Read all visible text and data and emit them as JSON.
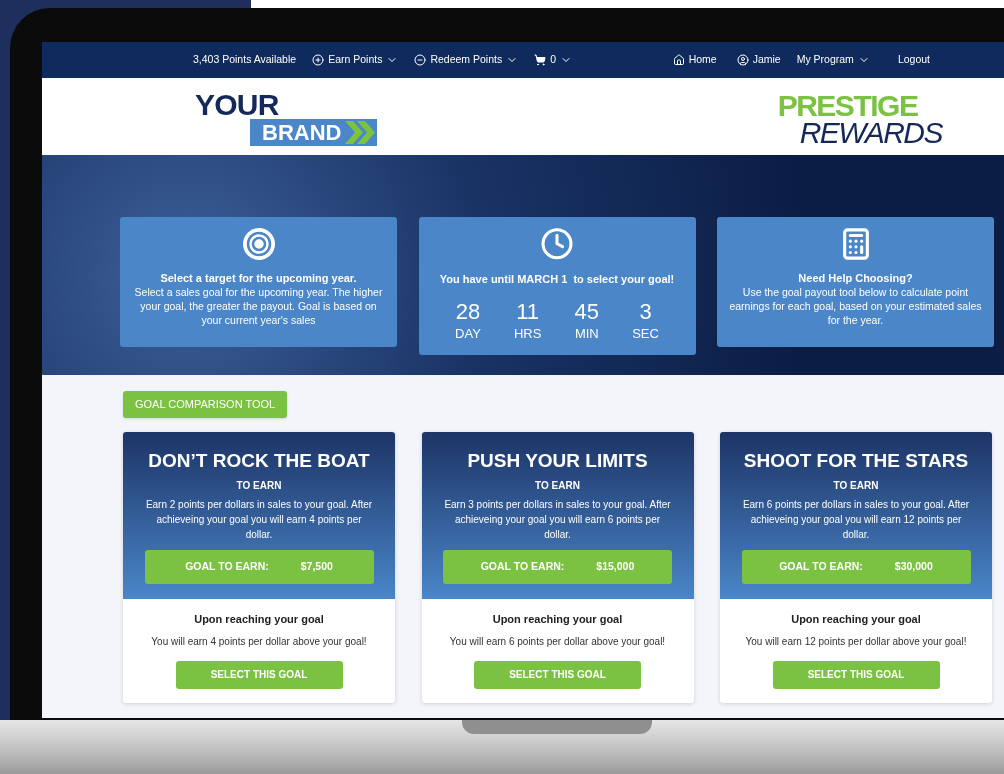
{
  "nav": {
    "points": "3,403 Points Available",
    "earn": "Earn Points",
    "redeem": "Redeem Points",
    "cart_count": "0",
    "home": "Home",
    "user": "Jamie",
    "program": "My Program",
    "logout": "Logout"
  },
  "brand": {
    "line1": "YOUR",
    "line2": "BRAND"
  },
  "program_logo": {
    "line1": "PRESTIGE",
    "line2": "REWARDS"
  },
  "hero_cards": [
    {
      "kind": "info",
      "title": "Select a target for the upcoming year.",
      "text": "Select a sales goal for the upcoming year. The higher your goal, the greater the payout. Goal is based on your current year's sales"
    },
    {
      "kind": "countdown",
      "title": "You have until MARCH 1  to select your goal!",
      "units": [
        {
          "value": "28",
          "label": "DAY"
        },
        {
          "value": "11",
          "label": "HRS"
        },
        {
          "value": "45",
          "label": "MIN"
        },
        {
          "value": "3",
          "label": "SEC"
        }
      ]
    },
    {
      "kind": "info",
      "title": "Need Help Choosing?",
      "text": "Use the goal payout tool below to calculate point earnings for each goal, based on your estimated sales for the year."
    }
  ],
  "comparison_button": "GOAL COMPARISON TOOL",
  "goals": [
    {
      "title": "DON’T ROCK THE BOAT",
      "subtitle": "TO EARN",
      "text": "Earn 2 points per dollars in sales to your goal. After achieveing your goal you will earn 4 points per dollar.",
      "goal_label": "GOAL TO EARN:",
      "goal_value": "$7,500",
      "reach_title": "Upon reaching your goal",
      "reach_text": "You will earn 4 points per dollar above your goal!",
      "button": "SELECT THIS GOAL"
    },
    {
      "title": "PUSH YOUR LIMITS",
      "subtitle": "TO EARN",
      "text": "Earn 3 points per dollars in sales to your goal. After achieveing your goal you will earn 6 points per dollar.",
      "goal_label": "GOAL TO EARN:",
      "goal_value": "$15,000",
      "reach_title": "Upon reaching your goal",
      "reach_text": "You will earn 6 points per dollar above your goal!",
      "button": "SELECT THIS GOAL"
    },
    {
      "title": "SHOOT FOR THE STARS",
      "subtitle": "TO EARN",
      "text": "Earn 6 points per dollars in sales to your goal. After achieveing your goal you will earn 12 points per dollar.",
      "goal_label": "GOAL TO EARN:",
      "goal_value": "$30,000",
      "reach_title": "Upon reaching your goal",
      "reach_text": "You will earn 12 points per dollar above your goal!",
      "button": "SELECT THIS GOAL"
    }
  ]
}
